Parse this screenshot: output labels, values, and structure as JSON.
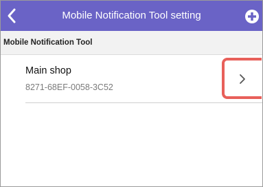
{
  "header": {
    "title": "Mobile Notification Tool setting",
    "back_icon": "chevron-left-icon",
    "add_icon": "plus-circle-icon",
    "background_color": "#6a63c6"
  },
  "section": {
    "title": "Mobile Notification Tool"
  },
  "items": [
    {
      "name": "Main shop",
      "id": "8271-68EF-0058-3C52",
      "icon": "chevron-right-icon"
    }
  ],
  "highlight_color": "#e8605a"
}
